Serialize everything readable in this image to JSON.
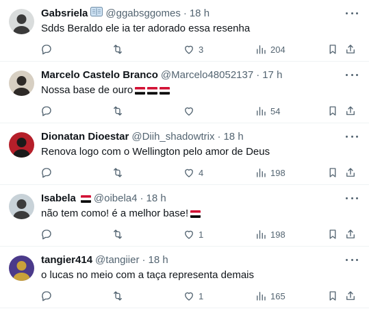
{
  "tweets": [
    {
      "name": "Gabsriela",
      "badge": "book",
      "handle": "@ggabsggomes",
      "time": "18 h",
      "text": "Sdds Beraldo ele ia ter adorado essa resenha",
      "flags_in_text": 0,
      "replies": "",
      "retweets": "",
      "likes": "3",
      "views": "204",
      "avatar_colors": [
        "#d9dcdc",
        "#3a3a3a"
      ]
    },
    {
      "name": "Marcelo Castelo Branco",
      "badge": "",
      "handle": "@Marcelo48052137",
      "time": "17 h",
      "text": "Nossa base de ouro",
      "flags_in_text": 3,
      "replies": "",
      "retweets": "",
      "likes": "",
      "views": "54",
      "avatar_colors": [
        "#d7cfc2",
        "#2e2a27"
      ]
    },
    {
      "name": "Dionatan Dioestar",
      "badge": "",
      "handle": "@Diih_shadowtrix",
      "time": "18 h",
      "text": "Renova logo com o Wellington pelo amor de Deus",
      "flags_in_text": 0,
      "replies": "",
      "retweets": "",
      "likes": "4",
      "views": "198",
      "avatar_colors": [
        "#b51f2a",
        "#1a1a1a"
      ]
    },
    {
      "name": "Isabela",
      "badge": "flag",
      "handle": "@oibela4",
      "time": "18 h",
      "text": "não tem como! é a melhor base!",
      "flags_in_text": 1,
      "replies": "",
      "retweets": "",
      "likes": "1",
      "views": "198",
      "avatar_colors": [
        "#c8d2d8",
        "#3b3b3b"
      ]
    },
    {
      "name": "tangier414",
      "badge": "",
      "handle": "@tangiier",
      "time": "18 h",
      "text": "o lucas no meio com a taça representa demais",
      "flags_in_text": 0,
      "replies": "",
      "retweets": "",
      "likes": "1",
      "views": "165",
      "avatar_colors": [
        "#4b3a8a",
        "#c9a13a"
      ]
    }
  ],
  "icons": {
    "reply": "reply-icon",
    "retweet": "retweet-icon",
    "like": "like-icon",
    "views": "views-icon",
    "bookmark": "bookmark-icon",
    "share": "share-icon",
    "more": "more-icon"
  },
  "colors": {
    "text_primary": "#0f1419",
    "text_secondary": "#536471",
    "divider": "#eff3f4",
    "flag_red": "#d21034",
    "flag_white": "#ffffff",
    "flag_black": "#000000"
  }
}
